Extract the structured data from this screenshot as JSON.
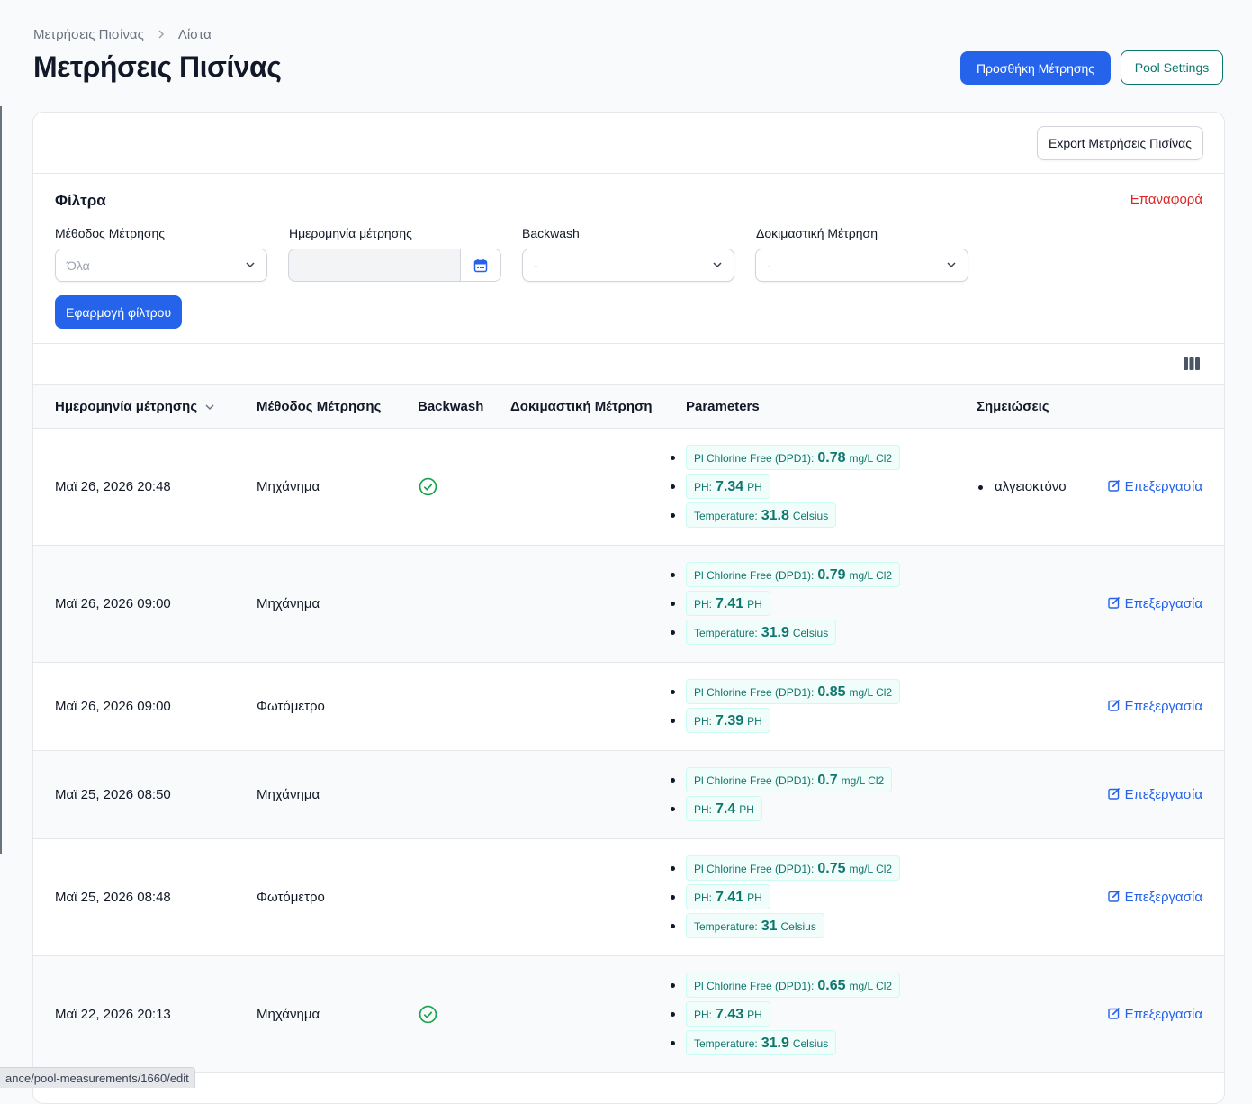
{
  "breadcrumb": {
    "parent": "Μετρήσεις Πισίνας",
    "current": "Λίστα"
  },
  "page_title": "Μετρήσεις Πισίνας",
  "header_actions": {
    "add": "Προσθήκη Μέτρησης",
    "settings": "Pool Settings"
  },
  "export_label": "Export Μετρήσεις Πισίνας",
  "filters": {
    "title": "Φίλτρα",
    "reset": "Επαναφορά",
    "method": {
      "label": "Μέθοδος Μέτρησης",
      "value": "Όλα"
    },
    "date": {
      "label": "Ημερομηνία μέτρησης",
      "value": ""
    },
    "backwash": {
      "label": "Backwash",
      "value": "-"
    },
    "test": {
      "label": "Δοκιμαστική Μέτρηση",
      "value": "-"
    },
    "apply": "Εφαρμογή φίλτρου"
  },
  "table": {
    "headers": {
      "date": "Ημερομηνία μέτρησης",
      "method": "Μέθοδος Μέτρησης",
      "backwash": "Backwash",
      "test": "Δοκιμαστική Μέτρηση",
      "params": "Parameters",
      "notes": "Σημειώσεις"
    },
    "edit_label": "Επεξεργασία",
    "rows": [
      {
        "date": "Μαϊ 26, 2026 20:48",
        "method": "Μηχάνημα",
        "backwash": true,
        "params": [
          {
            "name": "Pl Chlorine Free (DPD1):",
            "value": "0.78",
            "unit": "mg/L Cl2"
          },
          {
            "name": "PH:",
            "value": "7.34",
            "unit": "PH"
          },
          {
            "name": "Temperature:",
            "value": "31.8",
            "unit": "Celsius"
          }
        ],
        "notes": [
          "αλγειοκτόνο"
        ]
      },
      {
        "date": "Μαϊ 26, 2026 09:00",
        "method": "Μηχάνημα",
        "backwash": false,
        "params": [
          {
            "name": "Pl Chlorine Free (DPD1):",
            "value": "0.79",
            "unit": "mg/L Cl2"
          },
          {
            "name": "PH:",
            "value": "7.41",
            "unit": "PH"
          },
          {
            "name": "Temperature:",
            "value": "31.9",
            "unit": "Celsius"
          }
        ],
        "notes": []
      },
      {
        "date": "Μαϊ 26, 2026 09:00",
        "method": "Φωτόμετρο",
        "backwash": false,
        "params": [
          {
            "name": "Pl Chlorine Free (DPD1):",
            "value": "0.85",
            "unit": "mg/L Cl2"
          },
          {
            "name": "PH:",
            "value": "7.39",
            "unit": "PH"
          }
        ],
        "notes": []
      },
      {
        "date": "Μαϊ 25, 2026 08:50",
        "method": "Μηχάνημα",
        "backwash": false,
        "params": [
          {
            "name": "Pl Chlorine Free (DPD1):",
            "value": "0.7",
            "unit": "mg/L Cl2"
          },
          {
            "name": "PH:",
            "value": "7.4",
            "unit": "PH"
          }
        ],
        "notes": []
      },
      {
        "date": "Μαϊ 25, 2026 08:48",
        "method": "Φωτόμετρο",
        "backwash": false,
        "params": [
          {
            "name": "Pl Chlorine Free (DPD1):",
            "value": "0.75",
            "unit": "mg/L Cl2"
          },
          {
            "name": "PH:",
            "value": "7.41",
            "unit": "PH"
          },
          {
            "name": "Temperature:",
            "value": "31",
            "unit": "Celsius"
          }
        ],
        "notes": []
      },
      {
        "date": "Μαϊ 22, 2026 20:13",
        "method": "Μηχάνημα",
        "backwash": true,
        "params": [
          {
            "name": "Pl Chlorine Free (DPD1):",
            "value": "0.65",
            "unit": "mg/L Cl2"
          },
          {
            "name": "PH:",
            "value": "7.43",
            "unit": "PH"
          },
          {
            "name": "Temperature:",
            "value": "31.9",
            "unit": "Celsius"
          }
        ],
        "notes": []
      }
    ]
  },
  "status_url": "ance/pool-measurements/1660/edit",
  "colors": {
    "primary": "#2563eb",
    "teal": "#0f766e",
    "danger": "#dc2626",
    "success": "#16a34a"
  },
  "icons": {
    "calendar": "calendar-icon",
    "chevron": "chevron-down-icon",
    "columns": "columns-icon",
    "check": "check-circle-icon",
    "edit": "edit-icon"
  }
}
